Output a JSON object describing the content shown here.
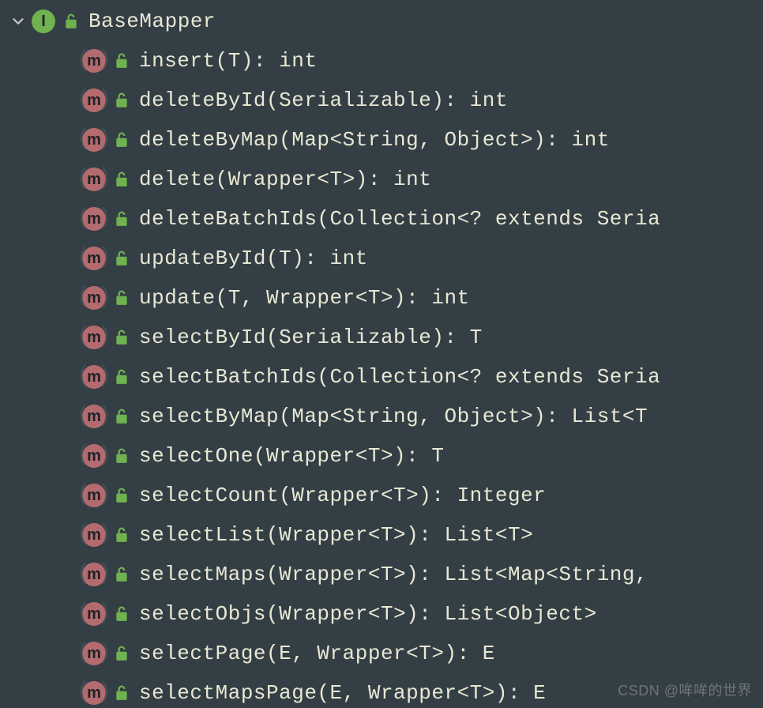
{
  "root": {
    "icon_letter": "I",
    "label": "BaseMapper"
  },
  "methods": [
    {
      "signature": "insert(T): int"
    },
    {
      "signature": "deleteById(Serializable): int"
    },
    {
      "signature": "deleteByMap(Map<String, Object>): int"
    },
    {
      "signature": "delete(Wrapper<T>): int"
    },
    {
      "signature": "deleteBatchIds(Collection<? extends Seria"
    },
    {
      "signature": "updateById(T): int"
    },
    {
      "signature": "update(T, Wrapper<T>): int"
    },
    {
      "signature": "selectById(Serializable): T"
    },
    {
      "signature": "selectBatchIds(Collection<? extends Seria"
    },
    {
      "signature": "selectByMap(Map<String, Object>): List<T"
    },
    {
      "signature": "selectOne(Wrapper<T>): T"
    },
    {
      "signature": "selectCount(Wrapper<T>): Integer"
    },
    {
      "signature": "selectList(Wrapper<T>): List<T>"
    },
    {
      "signature": "selectMaps(Wrapper<T>): List<Map<String,"
    },
    {
      "signature": "selectObjs(Wrapper<T>): List<Object>"
    },
    {
      "signature": "selectPage(E, Wrapper<T>): E"
    },
    {
      "signature": "selectMapsPage(E, Wrapper<T>): E"
    }
  ],
  "icons": {
    "method_letter": "m"
  },
  "watermark": "CSDN @哞哞的世界"
}
